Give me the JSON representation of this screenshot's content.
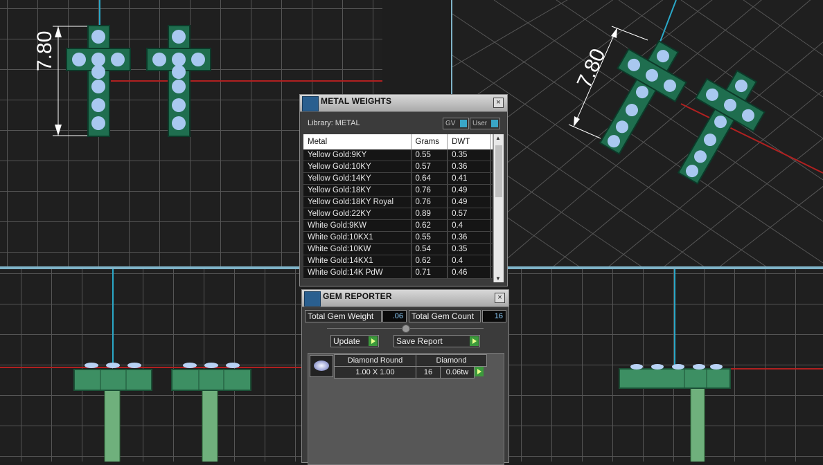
{
  "viewports": {
    "top_left": {
      "dimension": "7.80"
    },
    "top_right": {
      "dimension": "7.80"
    }
  },
  "metal_weights": {
    "title": "METAL WEIGHTS",
    "library_label": "Library: METAL",
    "toggle_gv": "GV",
    "toggle_user": "User",
    "close": "×",
    "columns": [
      "Metal",
      "Grams",
      "DWT"
    ],
    "rows": [
      {
        "metal": "Yellow Gold:9KY",
        "grams": "0.55",
        "dwt": "0.35"
      },
      {
        "metal": "Yellow Gold:10KY",
        "grams": "0.57",
        "dwt": "0.36"
      },
      {
        "metal": "Yellow Gold:14KY",
        "grams": "0.64",
        "dwt": "0.41"
      },
      {
        "metal": "Yellow Gold:18KY",
        "grams": "0.76",
        "dwt": "0.49"
      },
      {
        "metal": "Yellow Gold:18KY Royal",
        "grams": "0.76",
        "dwt": "0.49"
      },
      {
        "metal": "Yellow Gold:22KY",
        "grams": "0.89",
        "dwt": "0.57"
      },
      {
        "metal": "White Gold:9KW",
        "grams": "0.62",
        "dwt": "0.4"
      },
      {
        "metal": "White Gold:10KX1",
        "grams": "0.55",
        "dwt": "0.36"
      },
      {
        "metal": "White Gold:10KW",
        "grams": "0.54",
        "dwt": "0.35"
      },
      {
        "metal": "White Gold:14KX1",
        "grams": "0.62",
        "dwt": "0.4"
      },
      {
        "metal": "White Gold:14K PdW",
        "grams": "0.71",
        "dwt": "0.46"
      }
    ]
  },
  "gem_reporter": {
    "title": "GEM REPORTER",
    "close": "×",
    "total_weight_label": "Total Gem Weight",
    "total_weight_value": ".06",
    "total_count_label": "Total Gem Count",
    "total_count_value": "16",
    "update_label": "Update",
    "save_report_label": "Save Report",
    "gem": {
      "shape": "Diamond Round",
      "material": "Diamond",
      "size": "1.00 X 1.00",
      "count": "16",
      "weight": "0.06tw"
    }
  }
}
